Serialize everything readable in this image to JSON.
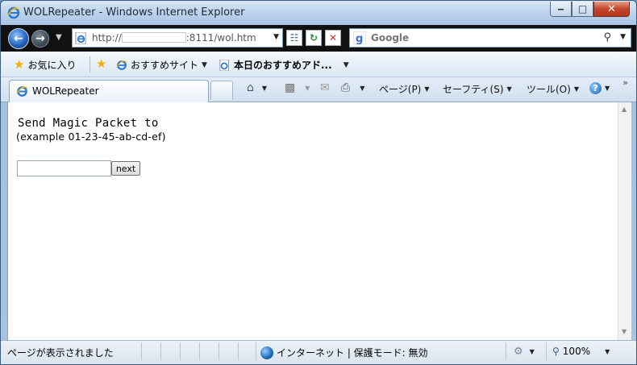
{
  "window": {
    "title": "WOLRepeater - Windows Internet Explorer",
    "minimize_label": "‒",
    "maximize_label": "□",
    "close_label": "✕"
  },
  "address": {
    "prefix": "http://",
    "suffix": ":8111/wol.htm"
  },
  "search": {
    "engine": "Google"
  },
  "favorites": {
    "label": "お気に入り",
    "items": [
      "おすすめサイト",
      "本日のおすすめアド..."
    ]
  },
  "tab": {
    "title": "WOLRepeater"
  },
  "command_bar": {
    "page": "ページ(P)",
    "safety": "セーフティ(S)",
    "tools": "ツール(O)",
    "help": "?"
  },
  "page": {
    "heading": "Send Magic Packet to",
    "example": "(example 01-23-45-ab-cd-ef)",
    "input_value": "",
    "button_label": "next"
  },
  "status": {
    "text": "ページが表示されました",
    "zone": "インターネット | 保護モード: 無効",
    "zoom": "100%"
  },
  "colors": {
    "accent": "#1f5eb8",
    "window_frame": "#a9c4e3",
    "close_button": "#c4452c"
  }
}
